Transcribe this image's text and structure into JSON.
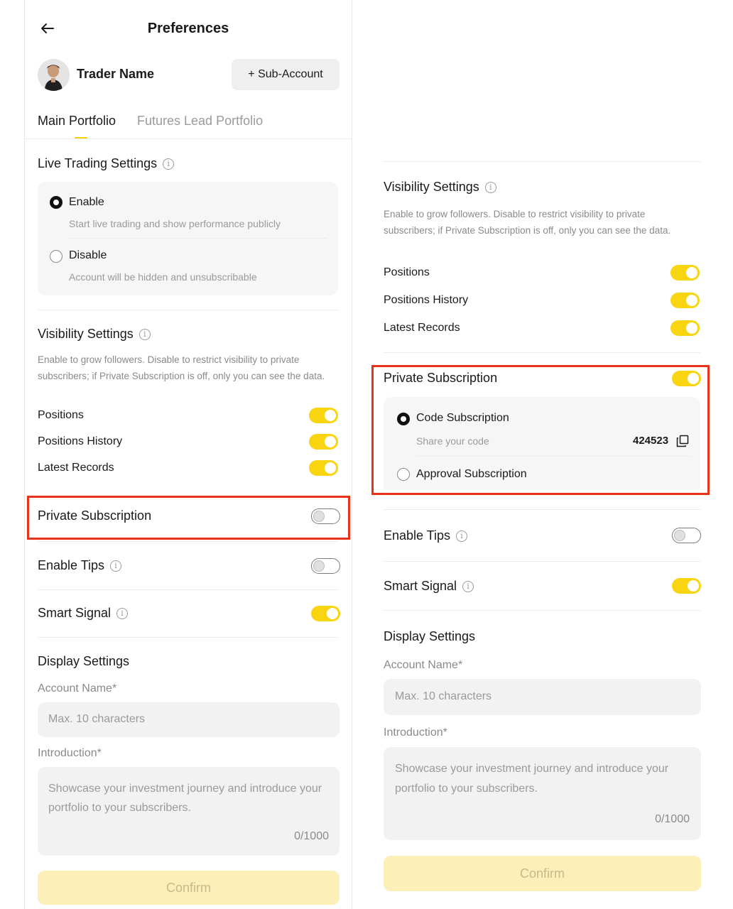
{
  "left": {
    "header": {
      "title": "Preferences"
    },
    "profile": {
      "name": "Trader Name",
      "sub_account_label": "+ Sub-Account"
    },
    "tabs": [
      {
        "label": "Main Portfolio",
        "active": true
      },
      {
        "label": "Futures Lead Portfolio",
        "active": false
      }
    ],
    "live_trading": {
      "title": "Live Trading Settings",
      "options": [
        {
          "label": "Enable",
          "description": "Start live trading and show performance publicly",
          "selected": true
        },
        {
          "label": "Disable",
          "description": "Account will be hidden and unsubscribable",
          "selected": false
        }
      ]
    },
    "visibility": {
      "title": "Visibility Settings",
      "description": "Enable to grow followers. Disable to restrict visibility to private subscribers; if Private Subscription is off, only you can see the data.",
      "items": [
        {
          "label": "Positions",
          "on": true
        },
        {
          "label": "Positions History",
          "on": true
        },
        {
          "label": "Latest Records",
          "on": true
        }
      ]
    },
    "private_subscription": {
      "label": "Private Subscription",
      "on": false
    },
    "enable_tips": {
      "label": "Enable Tips",
      "on": false
    },
    "smart_signal": {
      "label": "Smart Signal",
      "on": true
    },
    "display": {
      "title": "Display Settings",
      "account_name_label": "Account Name*",
      "account_name_placeholder": "Max. 10 characters",
      "intro_label": "Introduction*",
      "intro_placeholder": "Showcase your investment journey and introduce your portfolio to your subscribers.",
      "intro_counter": "0/1000"
    },
    "confirm_label": "Confirm"
  },
  "right": {
    "visibility": {
      "title": "Visibility Settings",
      "description": "Enable to grow followers. Disable to restrict visibility to private subscribers; if Private Subscription is off, only you can see the data.",
      "items": [
        {
          "label": "Positions",
          "on": true
        },
        {
          "label": "Positions History",
          "on": true
        },
        {
          "label": "Latest Records",
          "on": true
        }
      ]
    },
    "private_subscription": {
      "label": "Private Subscription",
      "on": true,
      "options": [
        {
          "label": "Code Subscription",
          "selected": true,
          "share_label": "Share your code",
          "code": "424523"
        },
        {
          "label": "Approval Subscription",
          "selected": false
        }
      ]
    },
    "enable_tips": {
      "label": "Enable Tips",
      "on": false
    },
    "smart_signal": {
      "label": "Smart Signal",
      "on": true
    },
    "display": {
      "title": "Display Settings",
      "account_name_label": "Account Name*",
      "account_name_placeholder": "Max. 10 characters",
      "intro_label": "Introduction*",
      "intro_placeholder": "Showcase your investment journey and introduce your portfolio to your subscribers.",
      "intro_counter": "0/1000"
    },
    "confirm_label": "Confirm"
  },
  "colors": {
    "accent": "#F8D411",
    "highlight": "#E8321A",
    "confirm_disabled": "#FCEFB8"
  }
}
